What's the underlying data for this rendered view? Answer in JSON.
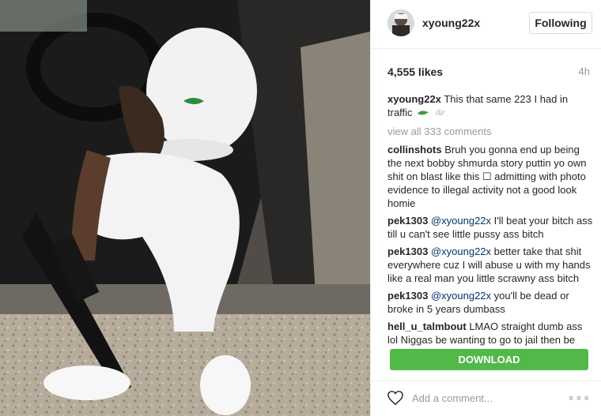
{
  "post": {
    "username": "xyoung22x",
    "follow_label": "Following",
    "likes": "4,555 likes",
    "time": "4h",
    "caption": {
      "user": "xyoung22x",
      "text": "This that same 223 I had in traffic"
    },
    "view_all": "view all 333 comments",
    "comments": [
      {
        "user": "collinshots",
        "mention": "",
        "text": "Bruh you gonna end up being the next bobby shmurda story puttin yo own shit on blast like this ☐ admitting with photo evidence to illegal activity not a good look homie"
      },
      {
        "user": "pek1303",
        "mention": "@xyoung22x",
        "text": "I'll beat your bitch ass till u can't see little pussy ass bitch"
      },
      {
        "user": "pek1303",
        "mention": "@xyoung22x",
        "text": "better take that shit everywhere cuz I will abuse u with my hands like a real man you little scrawny ass bitch"
      },
      {
        "user": "pek1303",
        "mention": "@xyoung22x",
        "text": "you'll be dead or broke in 5 years dumbass"
      },
      {
        "user": "hell_u_talmbout",
        "mention": "",
        "text": "LMAO straight dumb ass lol Niggas be wanting to go to jail then be"
      }
    ],
    "download_label": "DOWNLOAD",
    "add_comment_placeholder": "Add a comment...",
    "more_label": "∘∘∘"
  },
  "colors": {
    "download_green": "#52b848",
    "mention_blue": "#003569",
    "muted_gray": "#999999"
  }
}
